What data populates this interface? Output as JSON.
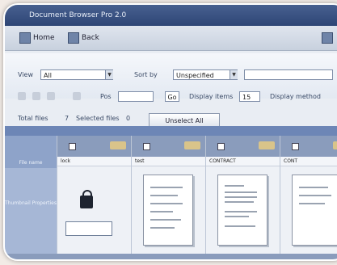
{
  "window": {
    "title": "Document Browser Pro 2.0"
  },
  "toolbar": {
    "home_label": "Home",
    "back_label": "Back"
  },
  "filters": {
    "view_label": "View",
    "view_value": "All",
    "sort_label": "Sort by",
    "sort_value": "Unspecified",
    "search_value": ""
  },
  "navigation": {
    "page_label": "Pos",
    "page_value": "",
    "go_label": "Go",
    "display_label": "Display items",
    "display_value": "15",
    "display_mode_label": "Display method"
  },
  "status": {
    "total_label": "Total files",
    "total_value": "7",
    "selected_label": "Selected files",
    "selected_value": "0",
    "unselect_label": "Unselect All"
  },
  "grid": {
    "side_header_label": "File name",
    "side_preview_label": "Thumbnail Properties",
    "columns": [
      {
        "name": "lock",
        "type": "locked"
      },
      {
        "name": "test",
        "type": "document"
      },
      {
        "name": "CONTRACT",
        "type": "document"
      },
      {
        "name": "CONT",
        "type": "document"
      }
    ]
  },
  "colors": {
    "accent": "#6d86b6",
    "sidebar": "#a6b7d6",
    "title_bar": "#2e4676"
  }
}
